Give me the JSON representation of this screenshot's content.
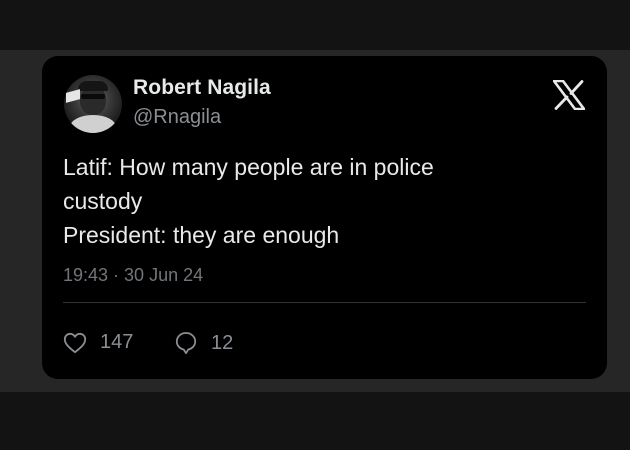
{
  "tweet": {
    "author": {
      "display_name": "Robert Nagila",
      "handle": "@Rnagila"
    },
    "text_lines": [
      "Latif: How many people are in police",
      "custody",
      "President: they are enough"
    ],
    "timestamp": "19:43 · 30 Jun 24",
    "likes": "147",
    "replies": "12"
  },
  "icons": {
    "brand": "x-logo-icon",
    "like": "heart-icon",
    "reply": "speech-bubble-icon",
    "avatar": "profile-photo"
  },
  "colors": {
    "card_background": "#000000",
    "backdrop": "#262626",
    "primary_text": "#e7e9ea",
    "secondary_text": "#8b8f93",
    "divider": "#2f3336"
  }
}
